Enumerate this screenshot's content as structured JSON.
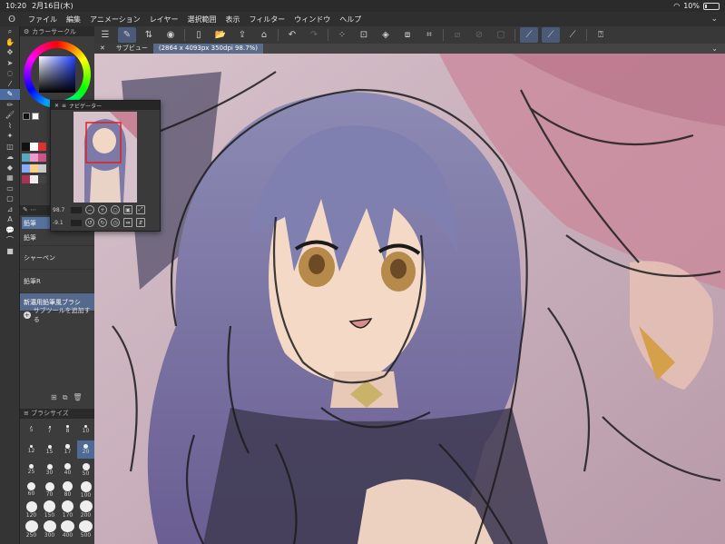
{
  "statusbar": {
    "time": "10:20",
    "date": "2月16日(木)",
    "battery": "10%"
  },
  "menubar": {
    "items": [
      "ファイル",
      "編集",
      "アニメーション",
      "レイヤー",
      "選択範囲",
      "表示",
      "フィルター",
      "ウィンドウ",
      "ヘルプ"
    ]
  },
  "toolbar": {
    "icons": [
      "menu-icon",
      "pen-tool-icon",
      "sync-icon",
      "camera-icon",
      "new-file-icon",
      "open-folder-icon",
      "save-icon",
      "undo-icon",
      "redo-icon",
      "lasso-icon",
      "fill-icon",
      "transform-icon",
      "crop-icon",
      "ruler-icon",
      "snap-icon",
      "snap-off-icon",
      "stroke-icon",
      "brush-icon",
      "stroke-correct-icon",
      "help-icon"
    ]
  },
  "leftpanel": {
    "color_wheel_title": "カラーサークル",
    "subtool_tab_pencil": "鉛筆",
    "subtool_tab_other": "",
    "subtools": [
      "鉛筆",
      "シャーペン",
      "鉛筆R",
      "新濃用鉛筆風ブラシ"
    ],
    "add_subtool": "サブツールを追加する",
    "brush_size_title": "ブラシサイズ",
    "brush_sizes": [
      "",
      "",
      "",
      "",
      "12",
      "15",
      "17",
      "20",
      "25",
      "30",
      "40",
      "50",
      "60",
      "70",
      "80",
      "100",
      "120",
      "150",
      "170",
      "200",
      "250",
      "300",
      "400",
      "500"
    ],
    "brush_sizes_top": [
      "5",
      "7",
      "8",
      "10"
    ]
  },
  "canvas": {
    "tab_sub": "サブビュー",
    "tab_main": "(2864 x 4093px 350dpi 98.7%)"
  },
  "navigator": {
    "title": "ナビゲーター",
    "zoom": "98.7",
    "rotation": "-9.1"
  },
  "colors": {
    "accent": "#4d6da0",
    "panel_bg": "#3c3c3c",
    "canvas_bg": "#c9b2bf"
  }
}
